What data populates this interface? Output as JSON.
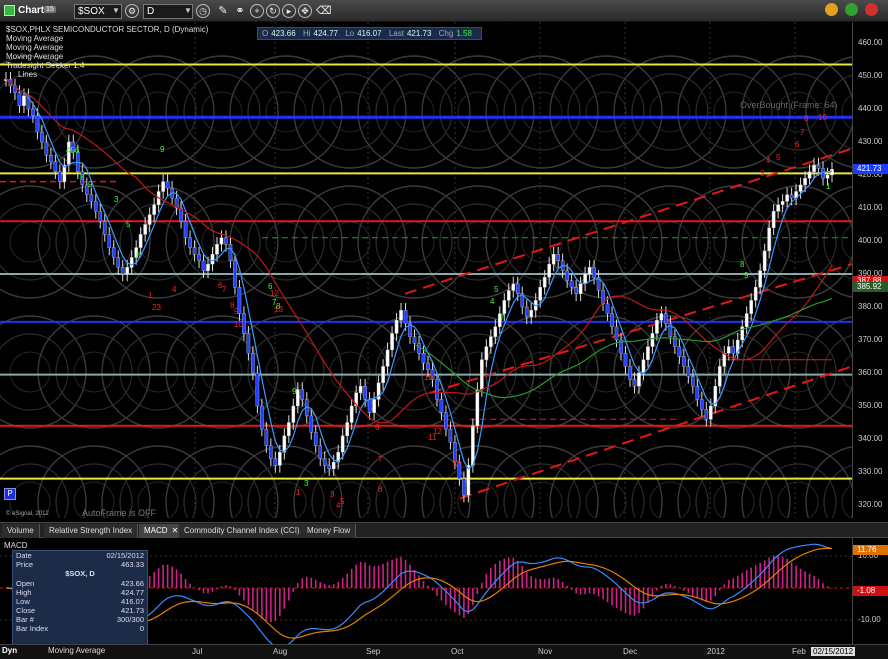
{
  "toolbar": {
    "title": "Chart",
    "badge": "15",
    "symbol_value": "$SOX",
    "interval_value": "D"
  },
  "legend": {
    "series_title": "$SOX,PHLX SEMICONDUCTOR SECTOR, D (Dynamic)",
    "studies": [
      "Moving Average",
      "Moving Average",
      "Moving Average",
      "Tradesight Seeker 1.4",
      "Lines"
    ]
  },
  "ohlc": {
    "o_label": "O",
    "o": "423.66",
    "hi_label": "Hi",
    "hi": "424.77",
    "lo_label": "Lo",
    "lo": "416.07",
    "last_label": "Last",
    "last": "421.73",
    "chg_label": "Chg",
    "chg": "1.58"
  },
  "annotations": {
    "overbought": "OverBought (Frame: 64)",
    "autoframe": "AutoFrame is OFF",
    "copyright": "© eSignal, 2012",
    "p_badge": "P"
  },
  "price_axis": {
    "ticks": [
      "460.00",
      "450.00",
      "440.00",
      "430.00",
      "420.00",
      "410.00",
      "400.00",
      "390.00",
      "380.00",
      "370.00",
      "360.00",
      "350.00",
      "340.00",
      "330.00",
      "320.00"
    ],
    "badges": [
      {
        "text": "421.73",
        "color": "#1a3cff"
      },
      {
        "text": "387.88",
        "color": "#d01010"
      },
      {
        "text": "385.92",
        "color": "#2a5a2a"
      }
    ]
  },
  "tabs": [
    {
      "label": "Volume",
      "active": false
    },
    {
      "label": "Relative Strength Index",
      "active": false
    },
    {
      "label": "MACD",
      "active": true,
      "closable": true
    },
    {
      "label": "Commodity Channel Index (CCI)",
      "active": false
    },
    {
      "label": "Money Flow",
      "active": false
    }
  ],
  "macd": {
    "title": "MACD",
    "axis_ticks": [
      "10.00",
      "-10.00"
    ],
    "badges": [
      {
        "text": "11.76",
        "color": "#e07000"
      },
      {
        "text": "-1.08",
        "color": "#d01010"
      }
    ]
  },
  "data_window": {
    "rows_top": [
      {
        "k": "Date",
        "v": "02/15/2012"
      },
      {
        "k": "Price",
        "v": "463.33"
      }
    ],
    "symbol": "$SOX, D",
    "rows": [
      {
        "k": "Open",
        "v": "423.66"
      },
      {
        "k": "High",
        "v": "424.77"
      },
      {
        "k": "Low",
        "v": "416.07"
      },
      {
        "k": "Close",
        "v": "421.73"
      },
      {
        "k": "Bar #",
        "v": "300/300"
      },
      {
        "k": "Bar Index",
        "v": "0"
      }
    ]
  },
  "date_axis": {
    "dyn": "Dyn",
    "footer": "Moving Average",
    "labels": [
      "Jul",
      "Aug",
      "Sep",
      "Oct",
      "Nov",
      "Dec",
      "2012",
      "Feb",
      "02/15/2012"
    ]
  },
  "seeker_labels": [
    {
      "t": "1",
      "c": "red"
    },
    {
      "t": "23",
      "c": "red"
    },
    {
      "t": "4",
      "c": "red"
    },
    {
      "t": "6",
      "c": "red"
    },
    {
      "t": "7",
      "c": "red"
    },
    {
      "t": "8",
      "c": "red"
    },
    {
      "t": "9",
      "c": "red"
    },
    {
      "t": "10",
      "c": "red"
    },
    {
      "t": "12",
      "c": "red"
    },
    {
      "t": "13",
      "c": "red"
    },
    {
      "t": "1",
      "c": "red"
    },
    {
      "t": "3",
      "c": "red"
    },
    {
      "t": "4",
      "c": "red"
    },
    {
      "t": "5",
      "c": "red"
    },
    {
      "t": "8",
      "c": "red"
    },
    {
      "t": "6",
      "c": "red"
    },
    {
      "t": "7",
      "c": "red"
    },
    {
      "t": "10",
      "c": "red"
    },
    {
      "t": "11",
      "c": "red"
    },
    {
      "t": "12",
      "c": "red"
    },
    {
      "t": "13",
      "c": "red"
    },
    {
      "t": "4",
      "c": "red"
    },
    {
      "t": "5",
      "c": "red"
    },
    {
      "t": "6",
      "c": "red"
    },
    {
      "t": "7",
      "c": "red"
    },
    {
      "t": "8",
      "c": "red"
    },
    {
      "t": "10",
      "c": "red"
    },
    {
      "t": "3",
      "c": "red"
    },
    {
      "t": "456",
      "c": "green"
    },
    {
      "t": "8",
      "c": "green"
    },
    {
      "t": "9",
      "c": "green"
    },
    {
      "t": "3",
      "c": "green"
    },
    {
      "t": "5",
      "c": "green"
    },
    {
      "t": "8",
      "c": "green"
    },
    {
      "t": "9",
      "c": "green"
    },
    {
      "t": "6",
      "c": "green"
    },
    {
      "t": "7",
      "c": "green"
    },
    {
      "t": "8",
      "c": "green"
    },
    {
      "t": "9",
      "c": "green"
    },
    {
      "t": "3",
      "c": "green"
    },
    {
      "t": "4",
      "c": "green"
    },
    {
      "t": "5",
      "c": "green"
    },
    {
      "t": "7",
      "c": "green"
    },
    {
      "t": "8",
      "c": "green"
    },
    {
      "t": "9",
      "c": "green"
    },
    {
      "t": "1",
      "c": "green"
    }
  ]
}
